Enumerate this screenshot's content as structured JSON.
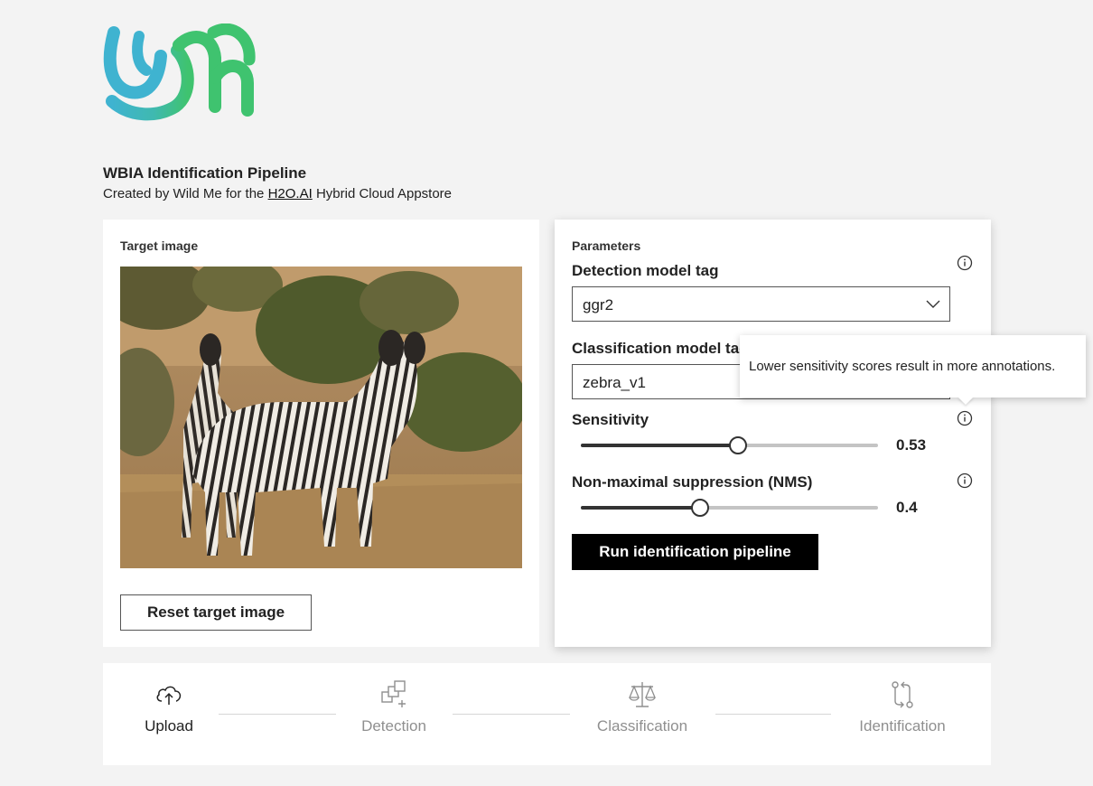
{
  "header": {
    "title": "WBIA Identification Pipeline",
    "subtitle_prefix": "Created by Wild Me for the",
    "subtitle_link": "H2O.AI",
    "subtitle_suffix": "Hybrid Cloud Appstore"
  },
  "left_card": {
    "label": "Target image",
    "reset_label": "Reset target image"
  },
  "parameters": {
    "heading": "Parameters",
    "detection": {
      "label": "Detection model tag",
      "value": "ggr2"
    },
    "classification": {
      "label": "Classification model tag",
      "value": "zebra_v1"
    },
    "sensitivity": {
      "label": "Sensitivity",
      "value": "0.53",
      "fraction": 0.53
    },
    "nms": {
      "label": "Non-maximal suppression (NMS)",
      "value": "0.4",
      "fraction": 0.4
    },
    "run_label": "Run identification pipeline"
  },
  "tooltip": {
    "text": "Lower sensitivity scores result in more annotations."
  },
  "steps": [
    {
      "label": "Upload",
      "icon": "cloud-upload-icon",
      "state": "active"
    },
    {
      "label": "Detection",
      "icon": "detection-icon",
      "state": "inactive"
    },
    {
      "label": "Classification",
      "icon": "scale-icon",
      "state": "inactive"
    },
    {
      "label": "Identification",
      "icon": "compare-icon",
      "state": "inactive"
    }
  ],
  "colors": {
    "background": "#f3f3f3",
    "logo_blue": "#3fb3d0",
    "logo_green": "#3fc36f",
    "button_primary": "#000000"
  }
}
